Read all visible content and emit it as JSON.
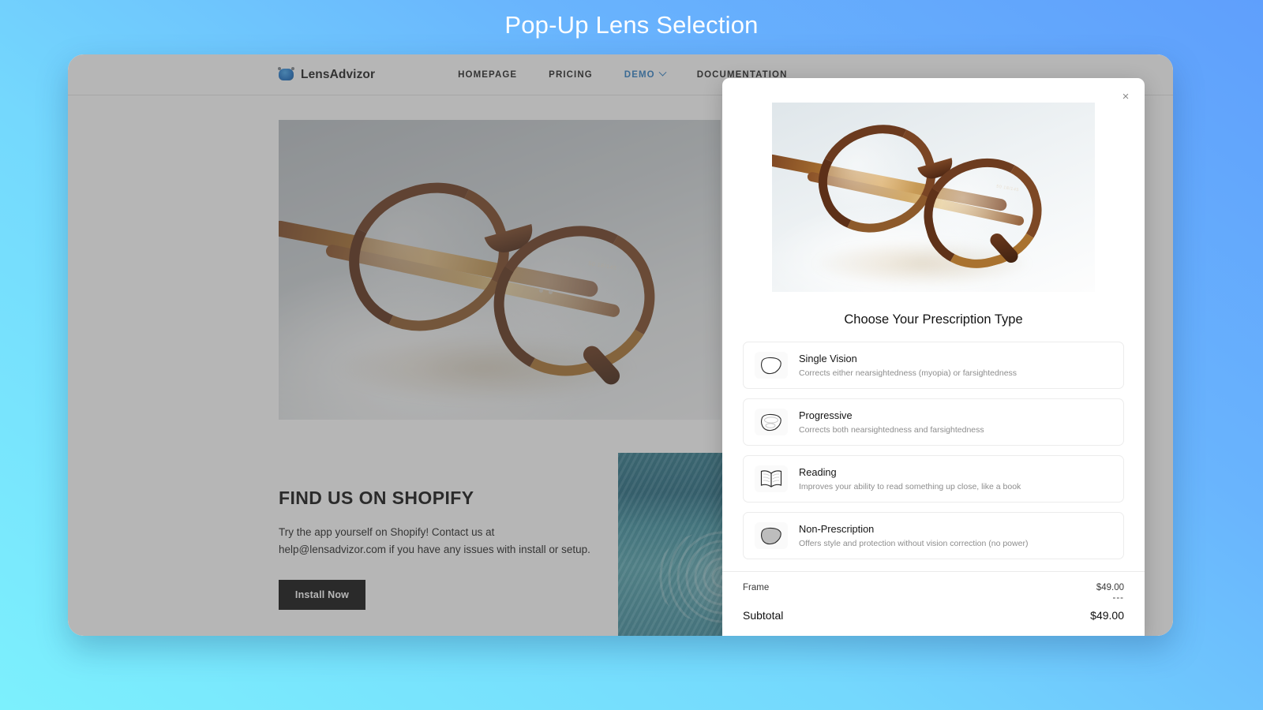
{
  "page_title": "Pop-Up Lens Selection",
  "site": {
    "brand": {
      "name": "LensAdvizor",
      "icon": "lens-logo-icon"
    },
    "nav": [
      {
        "label": "HOMEPAGE",
        "active": false
      },
      {
        "label": "PRICING",
        "active": false
      },
      {
        "label": "DEMO",
        "active": true,
        "has_dropdown": true
      },
      {
        "label": "DOCUMENTATION",
        "active": false
      }
    ],
    "hero_image_alt": "tortoiseshell-eyeglasses-photo",
    "hero_frame_spec": "50 18/145",
    "section": {
      "title": "FIND US ON SHOPIFY",
      "body": "Try the app yourself on Shopify! Contact us at help@lensadvizor.com if you have any issues with install or setup.",
      "cta_label": "Install Now"
    },
    "side_image_alt": "rippling-teal-water-photo"
  },
  "modal": {
    "close_icon": "close-icon",
    "close_label": "×",
    "hero_image_alt": "tortoiseshell-eyeglasses-photo",
    "hero_frame_spec": "50 18/145",
    "heading": "Choose Your Prescription Type",
    "options": [
      {
        "title": "Single Vision",
        "description": "Corrects either nearsightedness (myopia) or farsightedness",
        "icon": "single-vision-lens-icon"
      },
      {
        "title": "Progressive",
        "description": "Corrects both nearsightedness and farsightedness",
        "icon": "progressive-lens-icon"
      },
      {
        "title": "Reading",
        "description": "Improves your ability to read something up close, like a book",
        "icon": "open-book-icon"
      },
      {
        "title": "Non-Prescription",
        "description": "Offers style and protection without vision correction (no power)",
        "icon": "tinted-lens-icon"
      }
    ],
    "summary": {
      "frame_label": "Frame",
      "frame_price": "$49.00",
      "divider": "---",
      "subtotal_label": "Subtotal",
      "subtotal_price": "$49.00"
    }
  },
  "colors": {
    "accent_blue": "#2e7fc4",
    "bg_gradient_from": "#5f9ffc",
    "bg_gradient_to": "#7cf0fd",
    "cta_black": "#0e0e0e"
  }
}
